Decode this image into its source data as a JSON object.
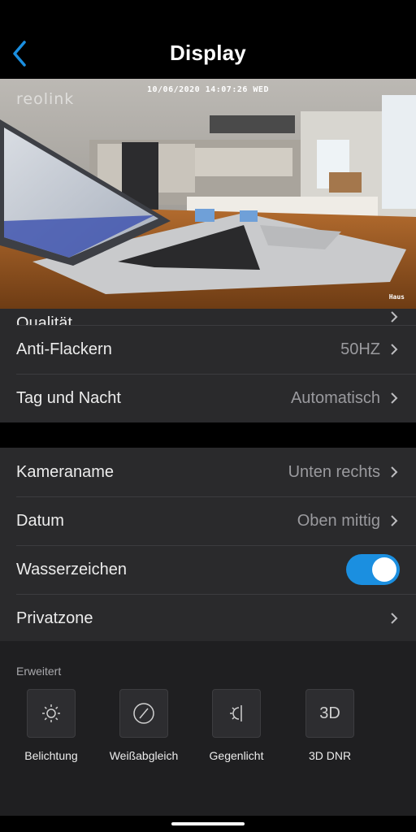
{
  "header": {
    "title": "Display",
    "back_icon": "chevron-left-icon",
    "accent": "#1b8fe0"
  },
  "preview": {
    "timestamp": "10/06/2020 14:07:26 WED",
    "logo": "reolink",
    "camera_name": "Haus"
  },
  "section1": {
    "rows": [
      {
        "label": "Qualität",
        "value": ""
      },
      {
        "label": "Anti-Flackern",
        "value": "50HZ"
      },
      {
        "label": "Tag und Nacht",
        "value": "Automatisch"
      }
    ]
  },
  "section2": {
    "rows": [
      {
        "label": "Kameraname",
        "value": "Unten rechts"
      },
      {
        "label": "Datum",
        "value": "Oben mittig"
      },
      {
        "label": "Wasserzeichen",
        "toggle_on": true
      },
      {
        "label": "Privatzone",
        "value": ""
      }
    ]
  },
  "advanced": {
    "title": "Erweitert",
    "items": [
      {
        "label": "Belichtung",
        "icon": "sun-icon"
      },
      {
        "label": "Weißabgleich",
        "icon": "white-balance-icon"
      },
      {
        "label": "Gegenlicht",
        "icon": "backlight-icon"
      },
      {
        "label": "3D DNR",
        "icon_text": "3D"
      }
    ]
  }
}
